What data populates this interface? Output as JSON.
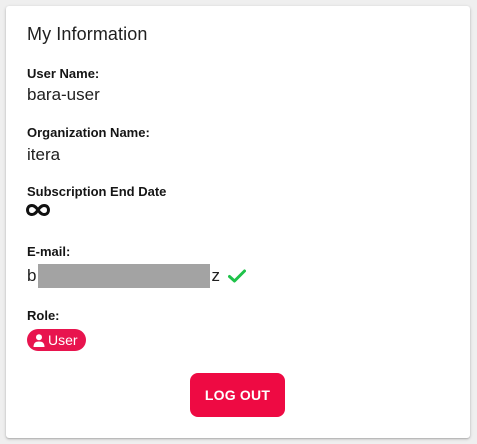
{
  "card": {
    "title": "My Information"
  },
  "fields": {
    "username": {
      "label": "User Name:",
      "value": "bara-user"
    },
    "organization": {
      "label": "Organization Name:",
      "value": "itera"
    },
    "subscription": {
      "label": "Subscription End Date",
      "value_icon": "infinity-icon"
    },
    "email": {
      "label": "E-mail:",
      "prefix": "b",
      "suffix": "z",
      "verified_icon": "check-icon"
    },
    "role": {
      "label": "Role:",
      "badge": "User",
      "badge_icon": "user-icon"
    }
  },
  "actions": {
    "logout_label": "LOG OUT"
  },
  "colors": {
    "accent": "#ee0a43",
    "badge": "#e8144e",
    "verified": "#1fc24a",
    "mask": "#a3a3a3"
  }
}
